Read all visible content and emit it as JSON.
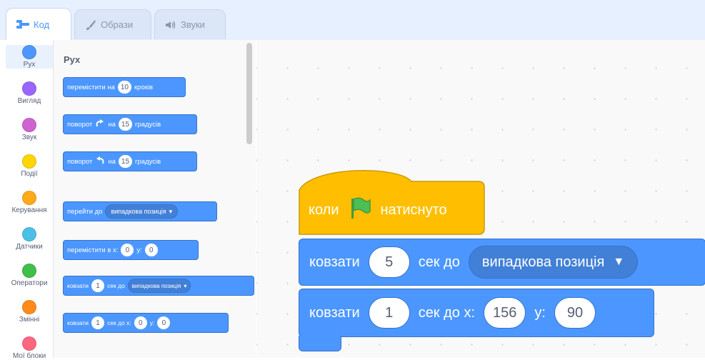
{
  "tabs": [
    {
      "label": "Код",
      "icon": "code-icon"
    },
    {
      "label": "Образи",
      "icon": "brush-icon"
    },
    {
      "label": "Звуки",
      "icon": "speaker-icon"
    }
  ],
  "categories": [
    {
      "label": "Рух",
      "color": "#4c97ff"
    },
    {
      "label": "Вигляд",
      "color": "#9966ff"
    },
    {
      "label": "Звук",
      "color": "#cf63cf"
    },
    {
      "label": "Події",
      "color": "#ffd500"
    },
    {
      "label": "Керування",
      "color": "#ffab19"
    },
    {
      "label": "Датчики",
      "color": "#4cbfe6"
    },
    {
      "label": "Оператори",
      "color": "#40bf4a"
    },
    {
      "label": "Змінні",
      "color": "#ff8c1a"
    },
    {
      "label": "Мої блоки",
      "color": "#ff6680"
    }
  ],
  "palette": {
    "section_title": "Рух",
    "move": {
      "text": "перемістити на",
      "steps": "10",
      "suffix": "кроків"
    },
    "turn_right": {
      "text": "поворот",
      "on": "на",
      "degrees": "15",
      "suffix": "градусів"
    },
    "turn_left": {
      "text": "поворот",
      "on": "на",
      "degrees": "15",
      "suffix": "градусів"
    },
    "goto": {
      "text": "перейти до",
      "option": "випадкова позиція"
    },
    "goto_xy": {
      "text": "перемістити в x:",
      "x": "0",
      "ylabel": "y:",
      "y": "0"
    },
    "glide_to": {
      "text": "ковзати",
      "secs": "1",
      "mid": "сек до",
      "option": "випадкова позиція"
    },
    "glide_xy": {
      "text": "ковзати",
      "secs": "1",
      "mid": "сек до x:",
      "x": "0",
      "ylabel": "y:",
      "y": "0"
    }
  },
  "script": {
    "hat": {
      "prefix": "коли",
      "suffix": "натиснуто"
    },
    "glide_to": {
      "text": "ковзати",
      "secs": "5",
      "mid": "сек до",
      "option": "випадкова позиція"
    },
    "glide_xy": {
      "text": "ковзати",
      "secs": "1",
      "mid": "сек до x:",
      "x": "156",
      "ylabel": "у:",
      "y": "90"
    }
  },
  "colors": {
    "motion": "#4c97ff",
    "events": "#ffbf00",
    "accent": "#4c97ff"
  }
}
